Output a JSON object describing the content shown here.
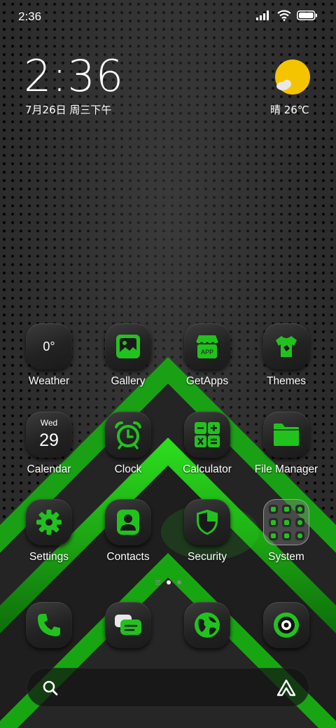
{
  "status_bar": {
    "time": "2:36"
  },
  "clock_widget": {
    "time": "2:36",
    "date": "7月26日 周三下午",
    "weather": "晴 26℃"
  },
  "apps": {
    "weather": {
      "label": "Weather",
      "temp": "0°"
    },
    "gallery": {
      "label": "Gallery"
    },
    "getapps": {
      "label": "GetApps",
      "badge": "APP"
    },
    "themes": {
      "label": "Themes"
    },
    "calendar": {
      "label": "Calendar",
      "weekday": "Wed",
      "day": "29"
    },
    "clock": {
      "label": "Clock"
    },
    "calculator": {
      "label": "Calculator"
    },
    "file_manager": {
      "label": "File Manager"
    },
    "settings": {
      "label": "Settings"
    },
    "contacts": {
      "label": "Contacts"
    },
    "security": {
      "label": "Security"
    },
    "system": {
      "label": "System"
    }
  },
  "dock": [
    "phone-icon",
    "messages-icon",
    "browser-icon",
    "camera-icon"
  ],
  "page_indicator": {
    "pages": 2,
    "current": 1
  },
  "search_bar": {
    "left_icon": "search-icon",
    "right_icon": "assistant-icon"
  },
  "colors": {
    "accent": "#22c21e",
    "icon_bg": "#262626",
    "sun": "#f5c400"
  }
}
